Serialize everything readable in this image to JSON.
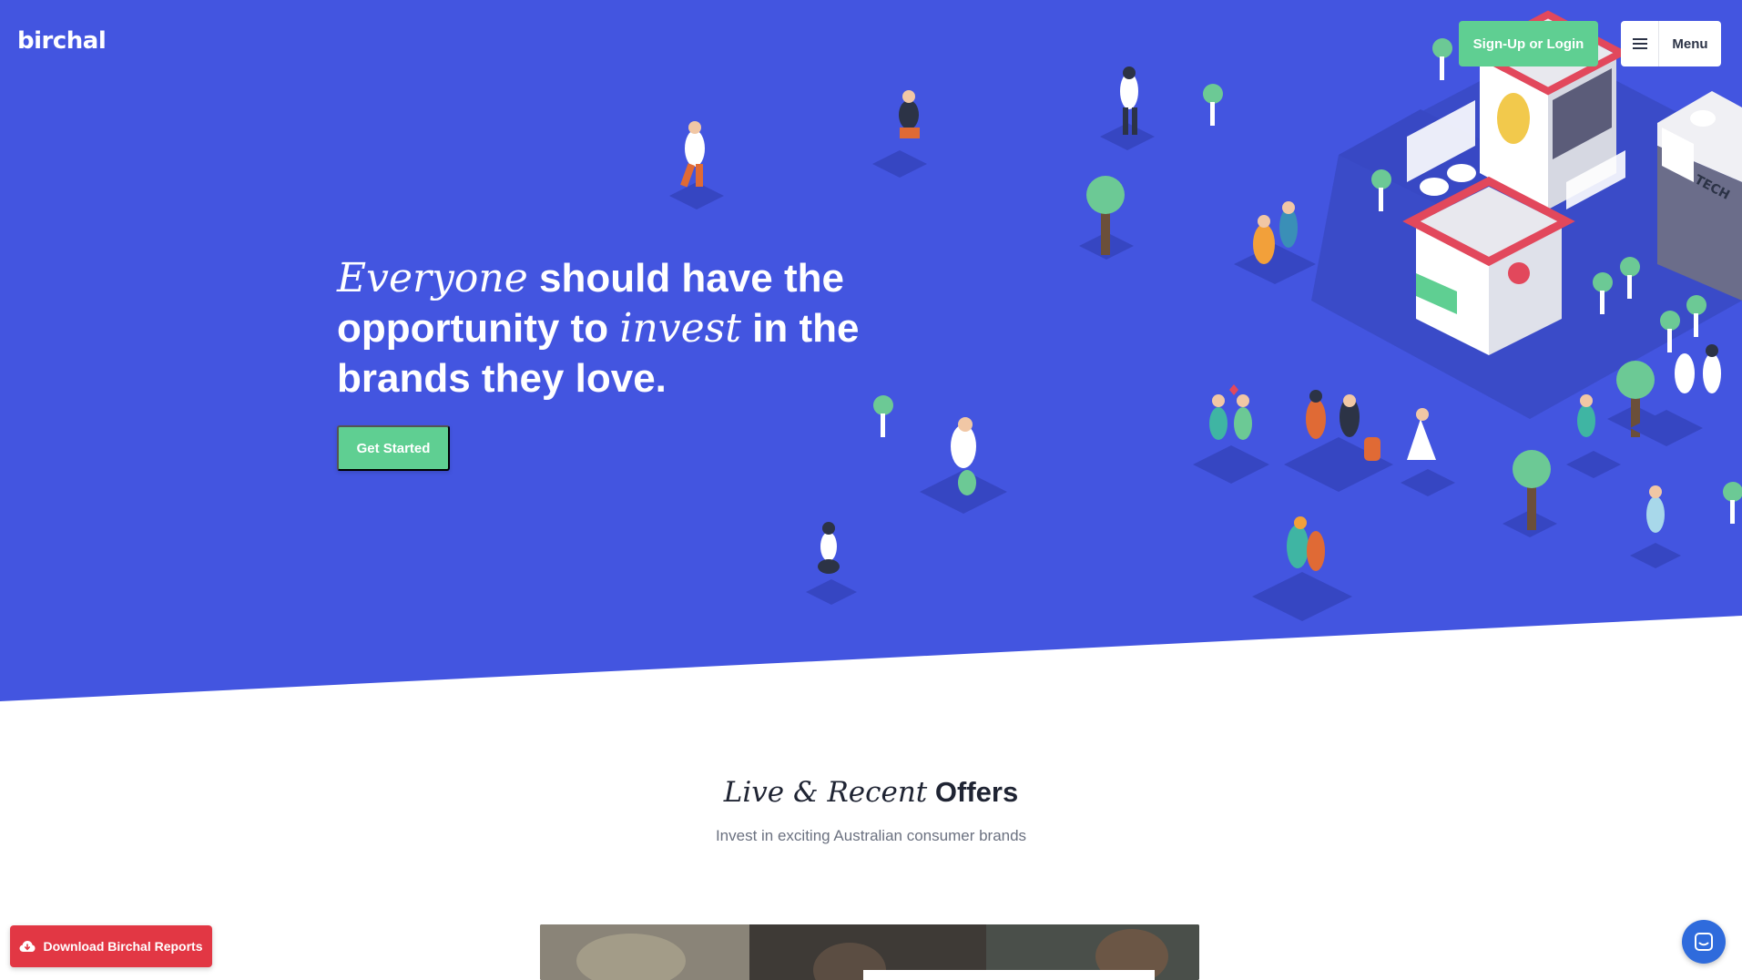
{
  "brand": {
    "logo_text": "birchal"
  },
  "header": {
    "signup_label": "Sign-Up or Login",
    "menu_label": "Menu",
    "menu_icon": "hamburger-icon"
  },
  "hero": {
    "headline_part1": "Everyone",
    "headline_part2": " should have the opportunity to ",
    "headline_part3": "invest",
    "headline_part4": " in the brands they love.",
    "cta_label": "Get Started",
    "illustration_text": "TECH"
  },
  "offers": {
    "title_serif": "Live & Recent",
    "title_bold": "Offers",
    "subtitle": "Invest in exciting Australian consumer brands"
  },
  "floating": {
    "download_label": "Download Birchal Reports",
    "download_icon": "cloud-download-icon",
    "chat_icon": "chat-icon"
  },
  "colors": {
    "hero_bg": "#4355e0",
    "accent_green": "#5fcf92",
    "download_red": "#e23744",
    "chat_blue": "#2f6bdc"
  }
}
